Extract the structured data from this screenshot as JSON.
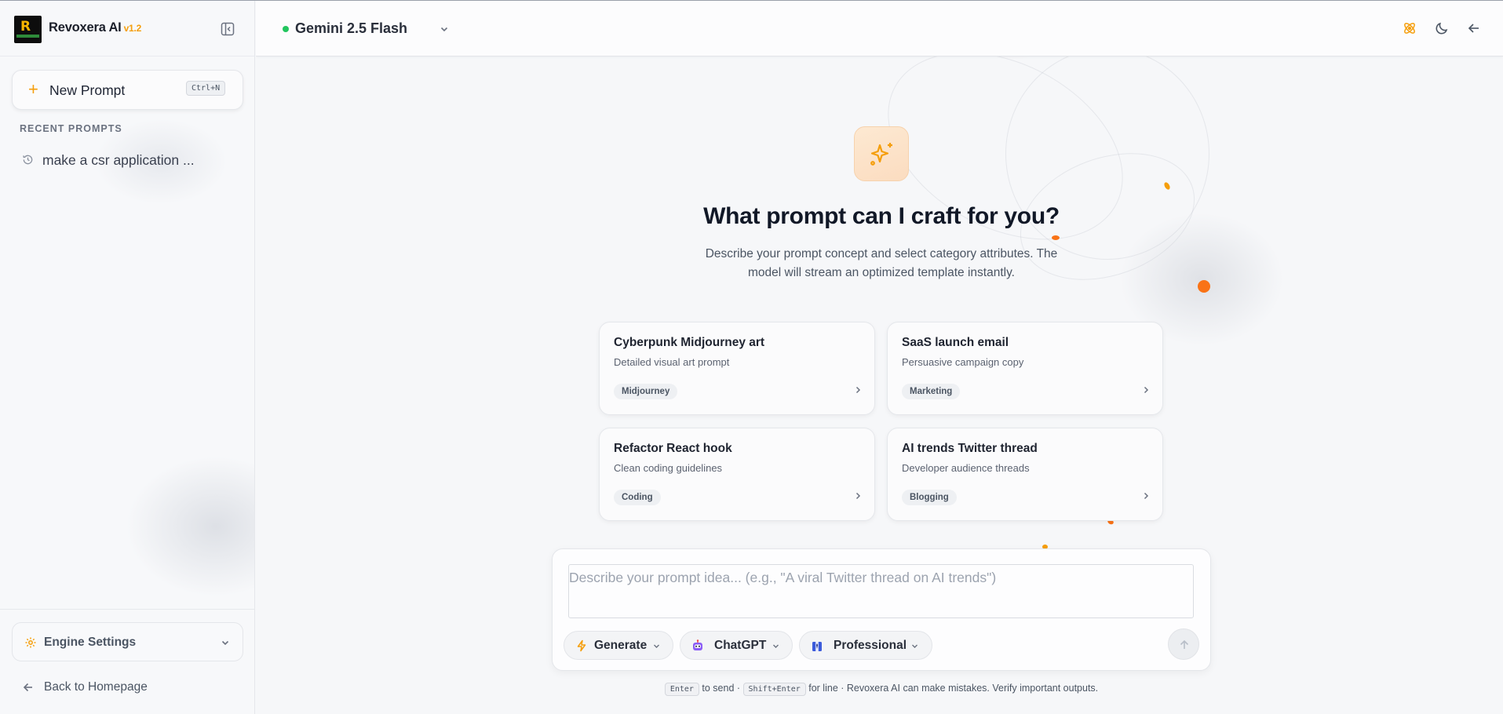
{
  "app": {
    "brand_name": "Revoxera AI",
    "version": "v1.2",
    "logo_letter": "R"
  },
  "sidebar": {
    "new_prompt_label": "New Prompt",
    "new_prompt_shortcut": "Ctrl+N",
    "recent_title": "RECENT PROMPTS",
    "recent_items": [
      {
        "label": "make a csr application ..."
      }
    ],
    "engine_settings_label": "Engine Settings",
    "back_home_label": "Back to Homepage"
  },
  "topbar": {
    "model_name": "Gemini 2.5 Flash",
    "model_status_color": "#22c55e"
  },
  "hero": {
    "title": "What prompt can I craft for you?",
    "subtitle": "Describe your prompt concept and select category attributes. The model will stream an optimized template instantly."
  },
  "suggestions": [
    {
      "title": "Cyberpunk Midjourney art",
      "desc": "Detailed visual art prompt",
      "tag": "Midjourney"
    },
    {
      "title": "SaaS launch email",
      "desc": "Persuasive campaign copy",
      "tag": "Marketing"
    },
    {
      "title": "Refactor React hook",
      "desc": "Clean coding guidelines",
      "tag": "Coding"
    },
    {
      "title": "AI trends Twitter thread",
      "desc": "Developer audience threads",
      "tag": "Blogging"
    }
  ],
  "composer": {
    "placeholder": "Describe your prompt idea... (e.g., \"A viral Twitter thread on AI trends\")",
    "value": "",
    "mode_label": "Generate",
    "target_label": "ChatGPT",
    "tone_label": "Professional"
  },
  "footer": {
    "enter_key": "Enter",
    "enter_text": "to send ·",
    "shift_enter_key": "Shift+Enter",
    "rest_text": "for line · Revoxera AI can make mistakes. Verify important outputs."
  },
  "colors": {
    "accent": "#f59e0b",
    "accent_orange": "#f97316"
  }
}
